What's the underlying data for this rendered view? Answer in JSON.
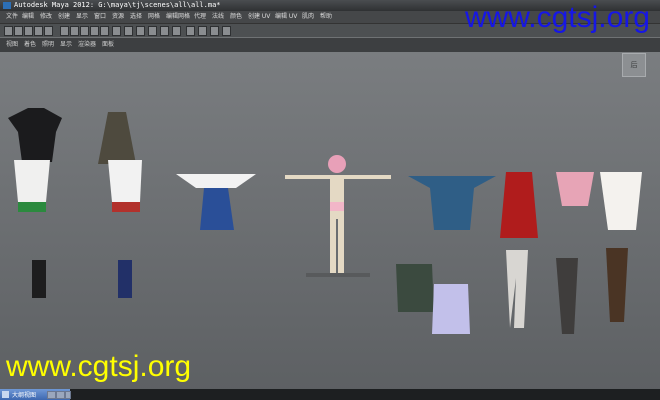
{
  "window": {
    "title": "Autodesk Maya 2012: G:\\maya\\tj\\scenes\\all\\all.ma*"
  },
  "watermark": {
    "top": "www.cgtsj.org",
    "bottom": "www.cgtsj.org"
  },
  "menu": {
    "items": [
      "文件",
      "编辑",
      "修改",
      "创建",
      "显示",
      "窗口",
      "资源",
      "选择",
      "网格",
      "编辑网格",
      "代理",
      "法线",
      "颜色",
      "创建 UV",
      "编辑 UV",
      "肌肉",
      "帮助"
    ]
  },
  "shelf": {
    "items": [
      "视图",
      "着色",
      "照明",
      "显示",
      "渲染器",
      "面板"
    ]
  },
  "view_cube": {
    "label": "后"
  },
  "outliner": {
    "label": "大纲视图"
  },
  "icons": [
    "maya-logo-icon",
    "shelf-tool-icon",
    "minimize-icon",
    "maximize-icon",
    "close-icon",
    "view-cube-icon"
  ],
  "colors": {
    "viewport_top": "#7a7d80",
    "viewport_bottom": "#5d6063",
    "watermark_top": "#1616e6",
    "watermark_bottom": "#ffff00",
    "outliner_tab": "#4e78c0"
  }
}
